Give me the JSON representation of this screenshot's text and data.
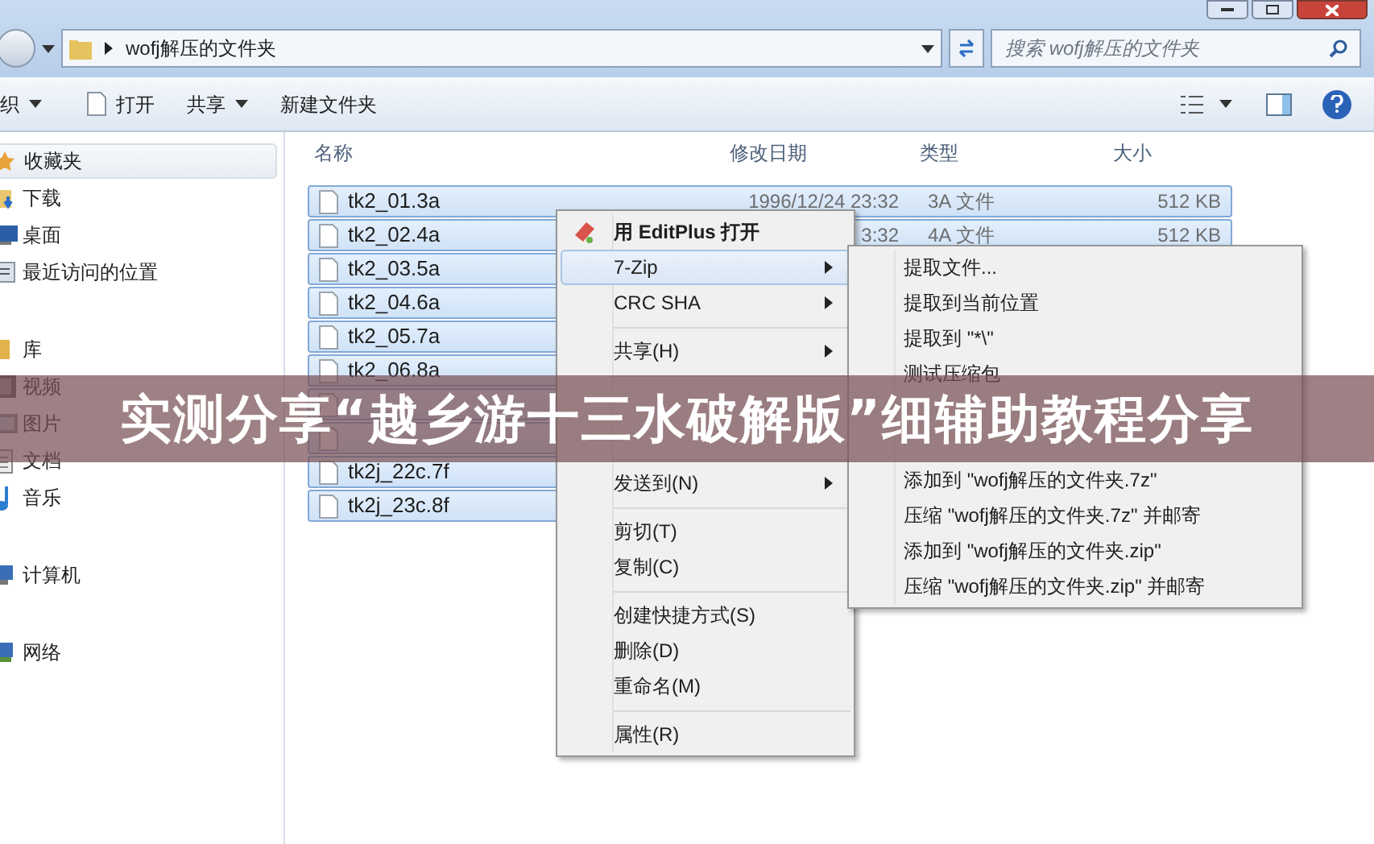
{
  "address_bar": {
    "path": "wofj解压的文件夹"
  },
  "search": {
    "placeholder": "搜索 wofj解压的文件夹"
  },
  "toolbar": {
    "items": [
      {
        "label": "织",
        "dropdown": true
      },
      {
        "label": "打开",
        "dropdown": false
      },
      {
        "label": "共享",
        "dropdown": true
      },
      {
        "label": "新建文件夹",
        "dropdown": false
      }
    ]
  },
  "sidebar": {
    "groups": [
      {
        "label": "收藏夹",
        "kind": "favorites",
        "selected": true,
        "children": [
          {
            "label": "下载",
            "kind": "download",
            "selected": false
          },
          {
            "label": "桌面",
            "kind": "desktop",
            "selected": false
          },
          {
            "label": "最近访问的位置",
            "kind": "recent",
            "selected": false
          }
        ]
      },
      {
        "label": "库",
        "kind": "library",
        "selected": false,
        "children": [
          {
            "label": "视频",
            "kind": "video",
            "selected": false
          },
          {
            "label": "图片",
            "kind": "picture",
            "selected": false
          },
          {
            "label": "文档",
            "kind": "document",
            "selected": false
          },
          {
            "label": "音乐",
            "kind": "music",
            "selected": false
          }
        ]
      },
      {
        "label": "计算机",
        "kind": "computer",
        "selected": false
      },
      {
        "label": "网络",
        "kind": "network",
        "selected": false
      }
    ]
  },
  "table": {
    "columns": [
      "名称",
      "修改日期",
      "类型",
      "大小"
    ],
    "rows": [
      {
        "name": "tk2_01.3a",
        "date": "1996/12/24 23:32",
        "type": "3A 文件",
        "size": "512 KB",
        "selected": true
      },
      {
        "name": "tk2_02.4a",
        "date": "3:32",
        "type": "4A 文件",
        "size": "512 KB",
        "selected": true
      },
      {
        "name": "tk2_03.5a",
        "selected": true
      },
      {
        "name": "tk2_04.6a",
        "selected": true
      },
      {
        "name": "tk2_05.7a",
        "selected": true
      },
      {
        "name": "tk2_06.8a",
        "selected": true
      },
      {
        "selected": true
      },
      {
        "selected": true
      },
      {
        "name": "tk2j_22c.7f",
        "selected": true
      },
      {
        "name": "tk2j_23c.8f",
        "selected": true
      }
    ]
  },
  "context_menu": {
    "items": [
      {
        "kind": "default",
        "label": "用 EditPlus 打开",
        "submenu": false,
        "selected": false
      },
      {
        "kind": "item",
        "label": "7-Zip",
        "submenu": true,
        "selected": true
      },
      {
        "kind": "item",
        "label": "CRC SHA",
        "submenu": true,
        "selected": false
      },
      {
        "kind": "separator"
      },
      {
        "kind": "item",
        "label": "共享(H)",
        "submenu": true,
        "selected": false
      },
      {
        "kind": "separator"
      },
      {
        "kind": "covered"
      },
      {
        "kind": "covered"
      },
      {
        "kind": "separator"
      },
      {
        "kind": "item",
        "label": "发送到(N)",
        "submenu": true,
        "selected": false
      },
      {
        "kind": "separator"
      },
      {
        "kind": "item",
        "label": "剪切(T)",
        "submenu": false,
        "selected": false
      },
      {
        "kind": "item",
        "label": "复制(C)",
        "submenu": false,
        "selected": false
      },
      {
        "kind": "separator"
      },
      {
        "kind": "item",
        "label": "创建快捷方式(S)",
        "submenu": false,
        "selected": false
      },
      {
        "kind": "item",
        "label": "删除(D)",
        "submenu": false,
        "selected": false
      },
      {
        "kind": "item",
        "label": "重命名(M)",
        "submenu": false,
        "selected": false
      },
      {
        "kind": "separator"
      },
      {
        "kind": "item",
        "label": "属性(R)",
        "submenu": false,
        "selected": false
      }
    ]
  },
  "submenu": {
    "items": [
      {
        "kind": "item",
        "label": "提取文件..."
      },
      {
        "kind": "item",
        "label": "提取到当前位置"
      },
      {
        "kind": "item",
        "label": "提取到 \"*\\\""
      },
      {
        "kind": "item",
        "label": "测试压缩包"
      },
      {
        "kind": "covered"
      },
      {
        "kind": "covered"
      },
      {
        "kind": "item",
        "label": "添加到 \"wofj解压的文件夹.7z\""
      },
      {
        "kind": "item",
        "label": "压缩 \"wofj解压的文件夹.7z\" 并邮寄"
      },
      {
        "kind": "item",
        "label": "添加到 \"wofj解压的文件夹.zip\""
      },
      {
        "kind": "item",
        "label": "压缩 \"wofj解压的文件夹.zip\" 并邮寄"
      }
    ]
  },
  "banner": {
    "text": "实测分享“越乡游十三水破解版”细辅助教程分享"
  }
}
